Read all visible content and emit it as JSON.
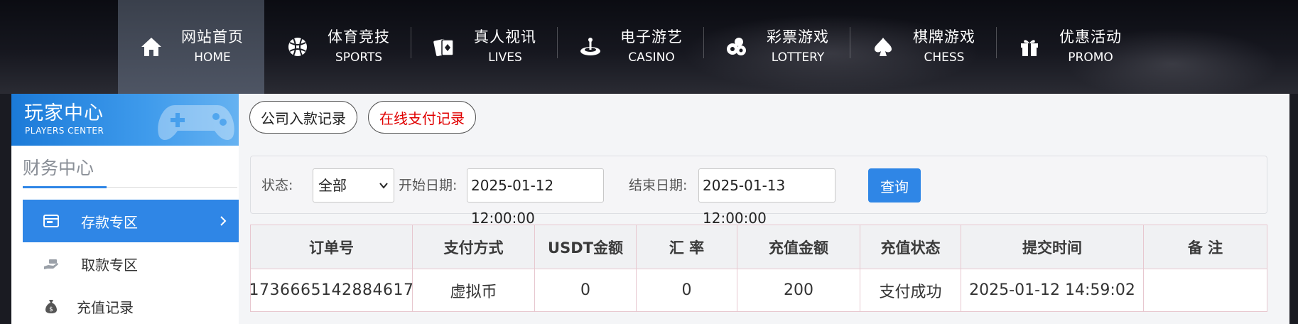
{
  "nav": {
    "items": [
      {
        "cn": "网站首页",
        "en": "HOME",
        "icon": "home-icon",
        "active": true
      },
      {
        "cn": "体育竞技",
        "en": "SPORTS",
        "icon": "basketball-icon"
      },
      {
        "cn": "真人视讯",
        "en": "LIVES",
        "icon": "playing-cards-icon"
      },
      {
        "cn": "电子游艺",
        "en": "CASINO",
        "icon": "roulette-icon"
      },
      {
        "cn": "彩票游戏",
        "en": "LOTTERY",
        "icon": "lottery-balls-icon"
      },
      {
        "cn": "棋牌游戏",
        "en": "CHESS",
        "icon": "spade-icon"
      },
      {
        "cn": "优惠活动",
        "en": "PROMO",
        "icon": "gift-icon"
      }
    ]
  },
  "players": {
    "title_cn": "玩家中心",
    "title_en": "PLAYERS CENTER"
  },
  "sidebar": {
    "section_title": "财务中心",
    "items": [
      {
        "label": "存款专区",
        "icon": "wallet-icon",
        "active": true
      },
      {
        "label": "取款专区",
        "icon": "withdraw-hand-icon"
      },
      {
        "label": "充值记录",
        "icon": "money-bag-icon"
      }
    ]
  },
  "tabs": [
    {
      "label": "公司入款记录"
    },
    {
      "label": "在线支付记录",
      "active": true
    }
  ],
  "filter": {
    "status_label": "状态:",
    "status_value": "全部",
    "start_label": "开始日期:",
    "start_value": "2025-01-12 12:00:00",
    "end_label": "结束日期:",
    "end_value": "2025-01-13 12:00:00",
    "query_label": "查询"
  },
  "table": {
    "headers": [
      "订单号",
      "支付方式",
      "USDT金额",
      "汇 率",
      "充值金额",
      "充值状态",
      "提交时间",
      "备 注"
    ],
    "rows": [
      [
        "1736665142884617",
        "虚拟币",
        "0",
        "0",
        "200",
        "支付成功",
        "2025-01-12 14:59:02",
        ""
      ]
    ]
  },
  "colors": {
    "accent": "#2f86e6",
    "active_tab_text": "#e00000",
    "nav_bg": "#111218"
  }
}
